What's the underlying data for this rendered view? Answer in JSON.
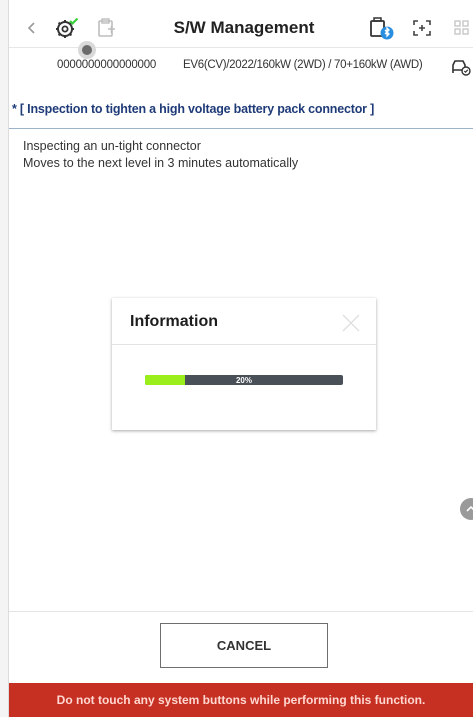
{
  "header": {
    "title": "S/W Management",
    "back_icon": "chevron-left-icon",
    "icons": [
      "diagnostic-gear-icon",
      "vehicle-doc-icon",
      "battery-bluetooth-icon",
      "fullscreen-icon",
      "grid-icon"
    ]
  },
  "vehicle": {
    "vin": "0000000000000000",
    "model": "EV6(CV)/2022/160kW (2WD) / 70+160kW (AWD)"
  },
  "section": {
    "title": "* [ Inspection to tighten a high voltage battery pack connector ]"
  },
  "content": {
    "line1": "Inspecting an un-tight connector",
    "line2": "Moves to the next level in 3 minutes automatically"
  },
  "modal": {
    "title": "Information",
    "progress": {
      "percent": 20,
      "label": "20%"
    }
  },
  "footer": {
    "cancel_label": "CANCEL",
    "warning": "Do not touch any system buttons while performing this function."
  },
  "colors": {
    "accent_text": "#1f3b78",
    "progress_fill": "#9aee1c",
    "progress_track": "#4a5058",
    "warning_bg": "#c53023"
  }
}
